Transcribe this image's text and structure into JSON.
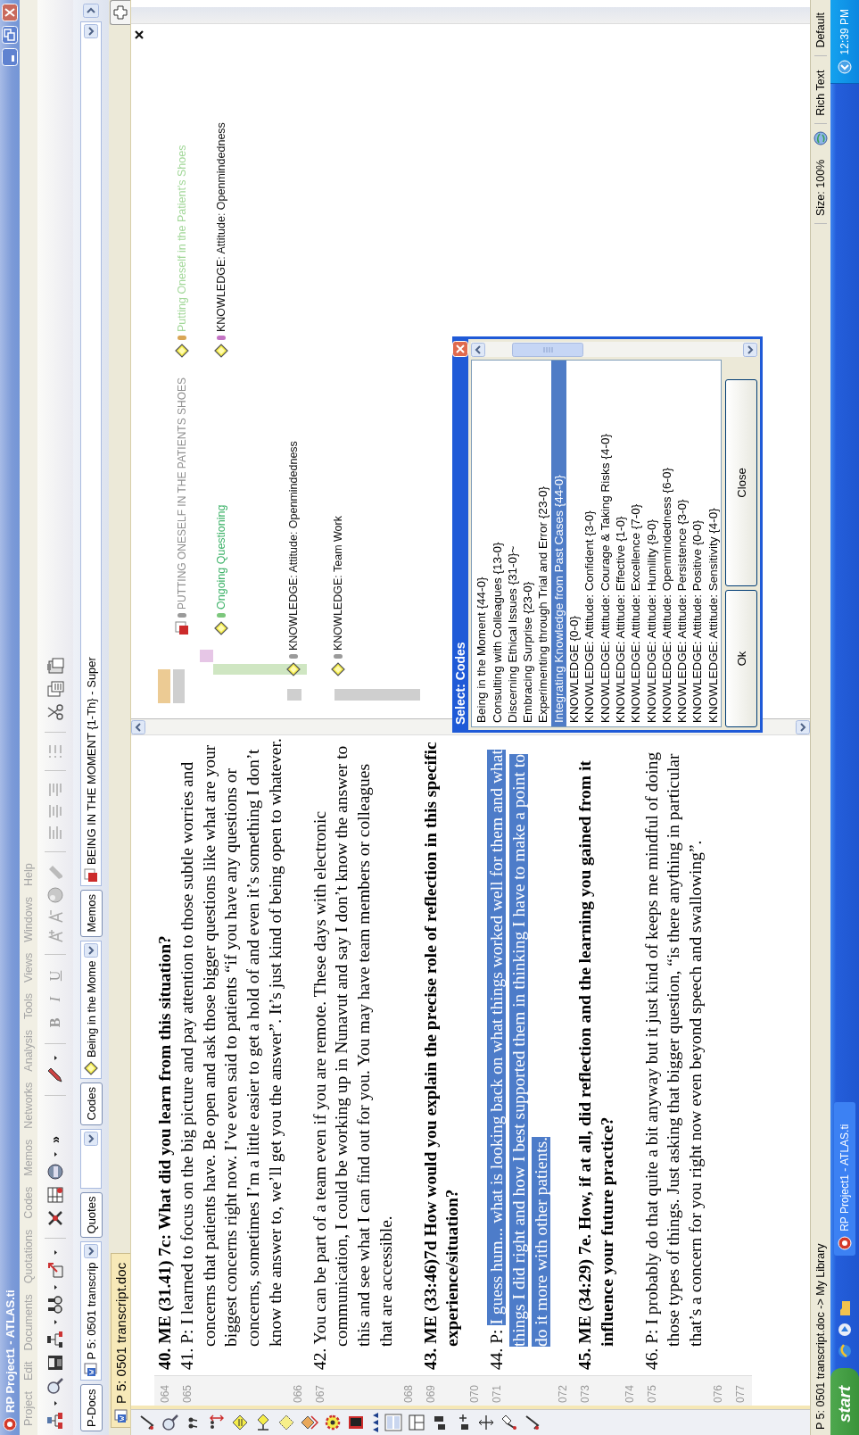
{
  "window": {
    "title": "RP Project1 - ATLAS.ti"
  },
  "menu": [
    {
      "label": "Project",
      "disabled": true
    },
    {
      "label": "Edit",
      "disabled": true
    },
    {
      "label": "Documents",
      "disabled": true
    },
    {
      "label": "Quotations",
      "disabled": true
    },
    {
      "label": "Codes",
      "disabled": true
    },
    {
      "label": "Memos",
      "disabled": true
    },
    {
      "label": "Networks",
      "disabled": true
    },
    {
      "label": "Analysis",
      "disabled": true
    },
    {
      "label": "Tools",
      "disabled": true
    },
    {
      "label": "Views",
      "disabled": true
    },
    {
      "label": "Windows",
      "disabled": true
    },
    {
      "label": "Help",
      "disabled": true
    }
  ],
  "toolbar": {
    "overflow": "»",
    "format_buttons": [
      "B",
      "I",
      "U"
    ]
  },
  "selectors": [
    {
      "kind": "button",
      "label": "P-Docs"
    },
    {
      "kind": "doc-combo",
      "value": "P 5: 0501 transcrip"
    },
    {
      "kind": "button",
      "label": "Quotes"
    },
    {
      "kind": "combo"
    },
    {
      "kind": "button",
      "label": "Codes"
    },
    {
      "kind": "code-combo",
      "value": "Being in the Mome"
    },
    {
      "kind": "button",
      "label": "Memos"
    },
    {
      "kind": "memo-combo",
      "value": "BEING IN THE MOMENT {1-Th} - Super"
    }
  ],
  "tab": {
    "label": "P 5: 0501 transcript.doc"
  },
  "document": {
    "rows": [
      {
        "number": "064",
        "kind": "heading",
        "text": "40. ME (31.41) 7c: What did you learn from this situation?"
      },
      {
        "number": "065",
        "kind": "body",
        "text": "41. P: I learned to focus on the big picture and pay attention to those subtle worries and concerns that patients have. Be open and ask those bigger questions like what are your biggest concerns right now. I’ve even said to patients “if you have any questions or concerns, sometimes I’m a little easier to get a hold of and even it’s something I don’t know the answer to, we’ll get you the answer”. It’s just kind of being open to whatever."
      },
      {
        "number": "066",
        "kind": "blank"
      },
      {
        "number": "067",
        "kind": "body",
        "text": "42. You can be part of a team even if you are remote. These days with electronic communication, I could be working up in Nunavut and say I don’t know the answer to this and see what I can find out for you. You may have team members or colleagues that are accessible."
      },
      {
        "number": "068",
        "kind": "blank"
      },
      {
        "number": "069",
        "kind": "heading",
        "text": "43. ME (33:46)7d How would you explain the precise role of reflection in this specific experience/situation?"
      },
      {
        "number": "070",
        "kind": "blank"
      },
      {
        "number": "071",
        "kind": "body",
        "text": "44. P: ",
        "highlight": "I guess hum... what is looking back on what things worked well for them and what things I did right and how I best supported them in thinking I have to make a point to do it more with other patients."
      },
      {
        "number": "072",
        "kind": "blank"
      },
      {
        "number": "073",
        "kind": "heading",
        "text": "45. ME (34:29) 7e. How, if at all, did reflection and the learning you gained from it influence your future practice?"
      },
      {
        "number": "074",
        "kind": "blank"
      },
      {
        "number": "075",
        "kind": "body",
        "text": "46. P: I probably do that quite a bit anyway but it just kind of keeps me mindful of doing those types of things. Just asking that bigger question, “is there anything in particular that’s a concern for you right now even beyond speech and swallowing”."
      },
      {
        "number": "076",
        "kind": "blank"
      },
      {
        "number": "077",
        "kind": "blank"
      }
    ]
  },
  "margin": {
    "codes": [
      {
        "kind": "memo",
        "label": "PUTTING ONESELF IN THE PATIENTS SHOES",
        "color": "#9a9a9a"
      },
      {
        "kind": "code-pale",
        "label": "Putting Oneself in the Patient's Shoes",
        "color": "#d9a656"
      },
      {
        "kind": "code-green",
        "label": "Ongoing Questioning",
        "color": "#7cc77c"
      },
      {
        "kind": "code",
        "label": "KNOWLEDGE: Attitude: Openmindedness",
        "color": "#c474c4"
      },
      {
        "kind": "code",
        "label": "KNOWLEDGE: Attitude: Openmindedness",
        "color": "#9a9a9a"
      },
      {
        "kind": "code",
        "label": "KNOWLEDGE: Team Work",
        "color": "#9a9a9a"
      }
    ]
  },
  "dialog": {
    "title": "Select: Codes",
    "items": [
      {
        "label": "Being in the Moment {44-0}",
        "selected": false
      },
      {
        "label": "Consulting with Colleagues {13-0}",
        "selected": false
      },
      {
        "label": "Discerning Ethical Issues {31-0}~",
        "selected": false
      },
      {
        "label": "Embracing Surprise {23-0}",
        "selected": false
      },
      {
        "label": "Experimenting through Trial and Error {23-0}",
        "selected": false
      },
      {
        "label": "Integrating Knowledge from Past Cases {44-0}",
        "selected": true
      },
      {
        "label": "KNOWLEDGE {0-0}",
        "selected": false
      },
      {
        "label": "KNOWLEDGE: Attitude: Confident {3-0}",
        "selected": false
      },
      {
        "label": "KNOWLEDGE: Attitude: Courage & Taking Risks {4-0}",
        "selected": false
      },
      {
        "label": "KNOWLEDGE: Attitude: Effective {1-0}",
        "selected": false
      },
      {
        "label": "KNOWLEDGE: Attitude: Excellence {7-0}",
        "selected": false
      },
      {
        "label": "KNOWLEDGE: Attitude: Humility {9-0}",
        "selected": false
      },
      {
        "label": "KNOWLEDGE: Attitude: Openmindedness {6-0}",
        "selected": false
      },
      {
        "label": "KNOWLEDGE: Attitude: Persistence {3-0}",
        "selected": false
      },
      {
        "label": "KNOWLEDGE: Attitude: Positive {0-0}",
        "selected": false
      },
      {
        "label": "KNOWLEDGE: Attitude: Sensitivity {4-0}",
        "selected": false
      }
    ],
    "buttons": [
      "Ok",
      "Close"
    ]
  },
  "status_bar": {
    "path": "P 5: 0501 transcript.doc -> My Library",
    "size": "Size: 100%",
    "format": "Rich Text",
    "style": "Default"
  },
  "taskbar": {
    "start": "start",
    "tasks": [
      "RP Project1 - ATLAS.ti"
    ],
    "clock": "12:39 PM"
  }
}
